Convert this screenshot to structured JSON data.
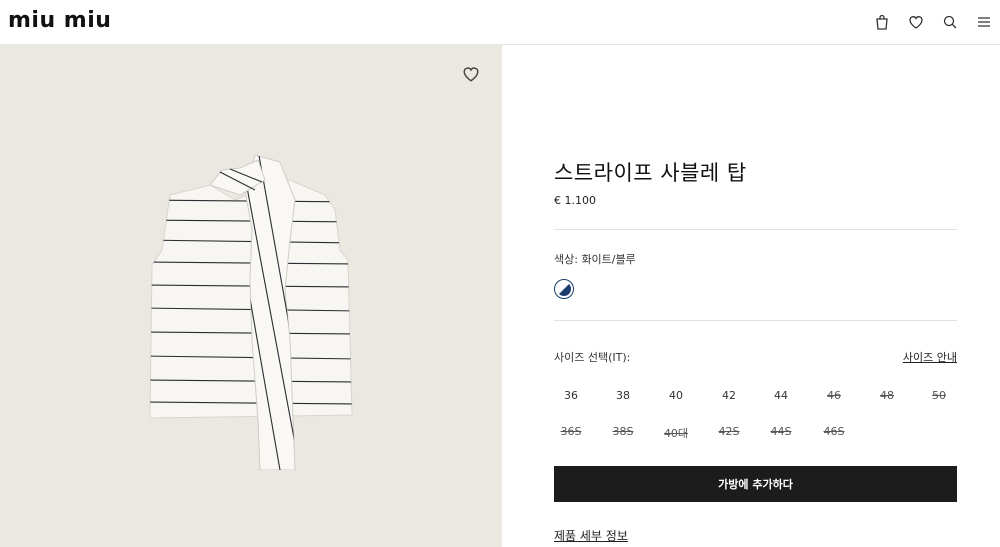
{
  "header": {
    "logo": "miu miu",
    "icons": [
      "bag-icon",
      "heart-icon",
      "search-icon",
      "menu-icon"
    ]
  },
  "product": {
    "title": "스트라이프 사블레 탑",
    "price": "€ 1.100",
    "color_label": "색상: 화이트/블루",
    "swatch_colors": [
      "#ffffff",
      "#1b3e6e"
    ],
    "size_label": "사이즈 선택(IT):",
    "size_guide": "사이즈 안내",
    "sizes_row1": [
      {
        "label": "36",
        "available": true
      },
      {
        "label": "38",
        "available": true
      },
      {
        "label": "40",
        "available": true
      },
      {
        "label": "42",
        "available": true
      },
      {
        "label": "44",
        "available": true
      },
      {
        "label": "46",
        "available": false
      },
      {
        "label": "48",
        "available": false
      },
      {
        "label": "50",
        "available": false
      }
    ],
    "sizes_row2": [
      {
        "label": "36S",
        "available": false
      },
      {
        "label": "38S",
        "available": false
      },
      {
        "label": "40대",
        "available": false
      },
      {
        "label": "42S",
        "available": false
      },
      {
        "label": "44S",
        "available": false
      },
      {
        "label": "46S",
        "available": false
      }
    ],
    "add_to_bag": "가방에 추가하다",
    "details_link": "제품 세부 정보"
  }
}
